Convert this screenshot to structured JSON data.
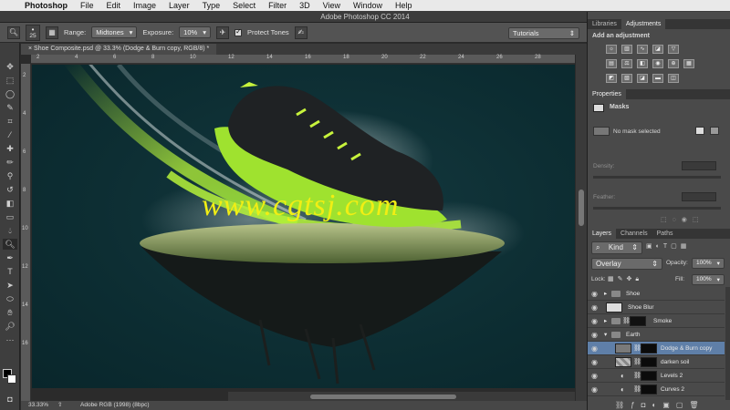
{
  "menubar": {
    "app": "Photoshop",
    "items": [
      "File",
      "Edit",
      "Image",
      "Layer",
      "Type",
      "Select",
      "Filter",
      "3D",
      "View",
      "Window",
      "Help"
    ]
  },
  "window_title": "Adobe Photoshop CC 2014",
  "options": {
    "brush_size": "25",
    "range_label": "Range:",
    "range_value": "Midtones",
    "exposure_label": "Exposure:",
    "exposure_value": "10%",
    "protect_tones_label": "Protect Tones",
    "protect_tones_checked": true,
    "workspace": "Tutorials"
  },
  "document": {
    "tab_title": "Shoe Composite.psd @ 33.3% (Dodge & Burn copy, RGB/8) *",
    "hruler_ticks": [
      "2",
      "4",
      "6",
      "8",
      "10",
      "12",
      "14",
      "16",
      "18",
      "20",
      "22",
      "24",
      "26",
      "28"
    ],
    "vruler_ticks": [
      "2",
      "4",
      "6",
      "8",
      "10",
      "12",
      "14",
      "16"
    ],
    "watermark": "www.cgtsj.com"
  },
  "status": {
    "zoom": "33.33%",
    "profile": "Adobe RGB (1998) (8bpc)"
  },
  "panels": {
    "top_tabs": [
      "Libraries",
      "Adjustments"
    ],
    "add_adjustment": "Add an adjustment",
    "properties_tab": "Properties",
    "masks_label": "Masks",
    "no_mask": "No mask selected",
    "density_label": "Density:",
    "feather_label": "Feather:",
    "layers_tabs": [
      "Layers",
      "Channels",
      "Paths"
    ],
    "kind_label": "Kind",
    "blend_mode": "Overlay",
    "opacity_label": "Opacity:",
    "opacity_value": "100%",
    "lock_label": "Lock:",
    "fill_label": "Fill:",
    "fill_value": "100%",
    "layers": [
      {
        "name": "Shoe",
        "type": "group"
      },
      {
        "name": "Shoe Blur",
        "type": "layer"
      },
      {
        "name": "Smoke",
        "type": "group"
      },
      {
        "name": "Earth",
        "type": "group-open"
      },
      {
        "name": "Dodge & Burn copy",
        "type": "layer",
        "selected": true
      },
      {
        "name": "darken soil",
        "type": "layer"
      },
      {
        "name": "Levels 2",
        "type": "adjustment"
      },
      {
        "name": "Curves 2",
        "type": "adjustment"
      }
    ]
  },
  "colors": {
    "accent_green": "#b6f23a",
    "watermark_yellow": "#f1ee14",
    "selected_layer": "#5f7fa8"
  }
}
